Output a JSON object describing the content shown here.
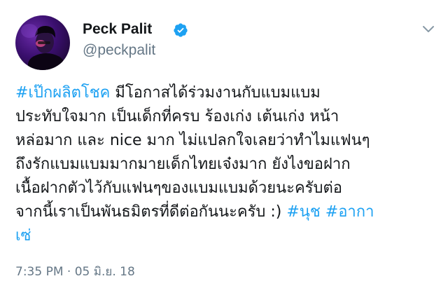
{
  "author": {
    "display_name": "Peck Palit",
    "handle": "@peckpalit",
    "verified": true,
    "verified_icon": "verified-badge-icon",
    "avatar_icon": "avatar-photo"
  },
  "header": {
    "menu_icon": "chevron-down-icon"
  },
  "tweet": {
    "lines": [
      {
        "hashtag": "#เป๊กผลิตโชค",
        "text": " มีโอกาสได้ร่วมงานกับแบมแบม"
      },
      {
        "text": "ประทับใจมาก เป็นเด็กที่ครบ ร้องเก่ง เต้นเก่ง หน้า"
      },
      {
        "text": "หล่อมาก และ nice มาก ไม่แปลกใจเลยว่าทำไมแฟนๆ"
      },
      {
        "text": "ถึงรักแบมแบมมากมายเด็กไทยเจ๋งมาก ยังไงขอฝาก"
      },
      {
        "text": "เนื้อฝากตัวไว้กับแฟนๆของแบมแบมด้วยนะครับต่อ"
      },
      {
        "text": "จากนี้เราเป็นพันธมิตรที่ดีต่อกันนะครับ :) ",
        "hashtag_a": "#นุช",
        "space": " ",
        "hashtag_b": "#อากา"
      },
      {
        "hashtag": "เซ่"
      }
    ]
  },
  "meta": {
    "timestamp": "7:35 PM · 05 มิ.ย. 18"
  },
  "colors": {
    "hashtag": "#1da1f2",
    "secondary_text": "#657786",
    "verified": "#1da1f2"
  }
}
